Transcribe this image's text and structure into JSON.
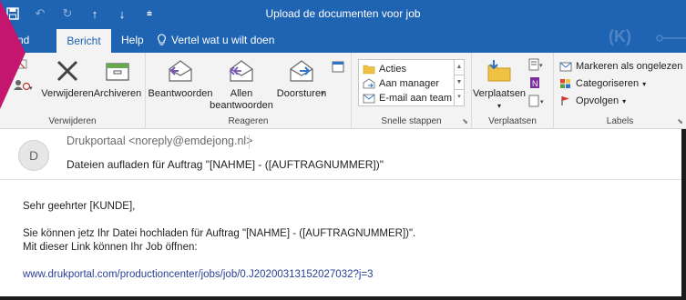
{
  "window": {
    "title": "Upload de documenten voor job"
  },
  "qat": {
    "save_icon": "save-icon",
    "undo_icon": "undo-icon",
    "redo_icon": "redo-icon",
    "up_icon": "arrow-up-icon",
    "down_icon": "arrow-down-icon",
    "customize_icon": "customize-qat-icon"
  },
  "tabs": [
    {
      "label": "stand"
    },
    {
      "label": "Bericht"
    },
    {
      "label": "Help"
    }
  ],
  "tell_me": {
    "label": "Vertel wat u wilt doen"
  },
  "watermark": "(K)",
  "ribbon": {
    "groups": {
      "verwijderen": {
        "label": "Verwijderen",
        "buttons": {
          "verwijderen": "Verwijderen",
          "archiveren": "Archiveren"
        }
      },
      "reageren": {
        "label": "Reageren",
        "buttons": {
          "beantwoorden": "Beantwoorden",
          "allen_line1": "Allen",
          "allen_line2": "beantwoorden",
          "doorsturen": "Doorsturen"
        }
      },
      "snelle_stappen": {
        "label": "Snelle stappen",
        "items": [
          "Acties",
          "Aan manager",
          "E-mail aan team"
        ]
      },
      "verplaatsen": {
        "label": "Verplaatsen",
        "buttons": {
          "verplaatsen": "Verplaatsen"
        }
      },
      "labels": {
        "label": "Labels",
        "items": {
          "markeren": "Markeren als ongelezen",
          "categoriseren": "Categoriseren",
          "opvolgen": "Opvolgen"
        }
      }
    }
  },
  "message": {
    "avatar_initial": "D",
    "sender": "Drukportaal <noreply@emdejong.nl>",
    "subject": "Dateien aufladen für Auftrag  \"[NAHME] - ([AUFTRAGNUMMER])\"",
    "greeting": "Sehr geehrter [KUNDE],",
    "line1": "Sie können jetz Ihr Datei hochladen für Auftrag \"[NAHME] - ([AUFTRAGNUMMER])\".",
    "line2": "Mit dieser Link können Ihr Job öffnen:",
    "link": "www.drukportal.com/productioncenter/jobs/job/0.J20200313152027032?j=3"
  },
  "colors": {
    "titlebar": "#1f63b3",
    "ribbon": "#f3f3f3",
    "accent_corner": "#c4166f",
    "link": "#2a3f96"
  }
}
